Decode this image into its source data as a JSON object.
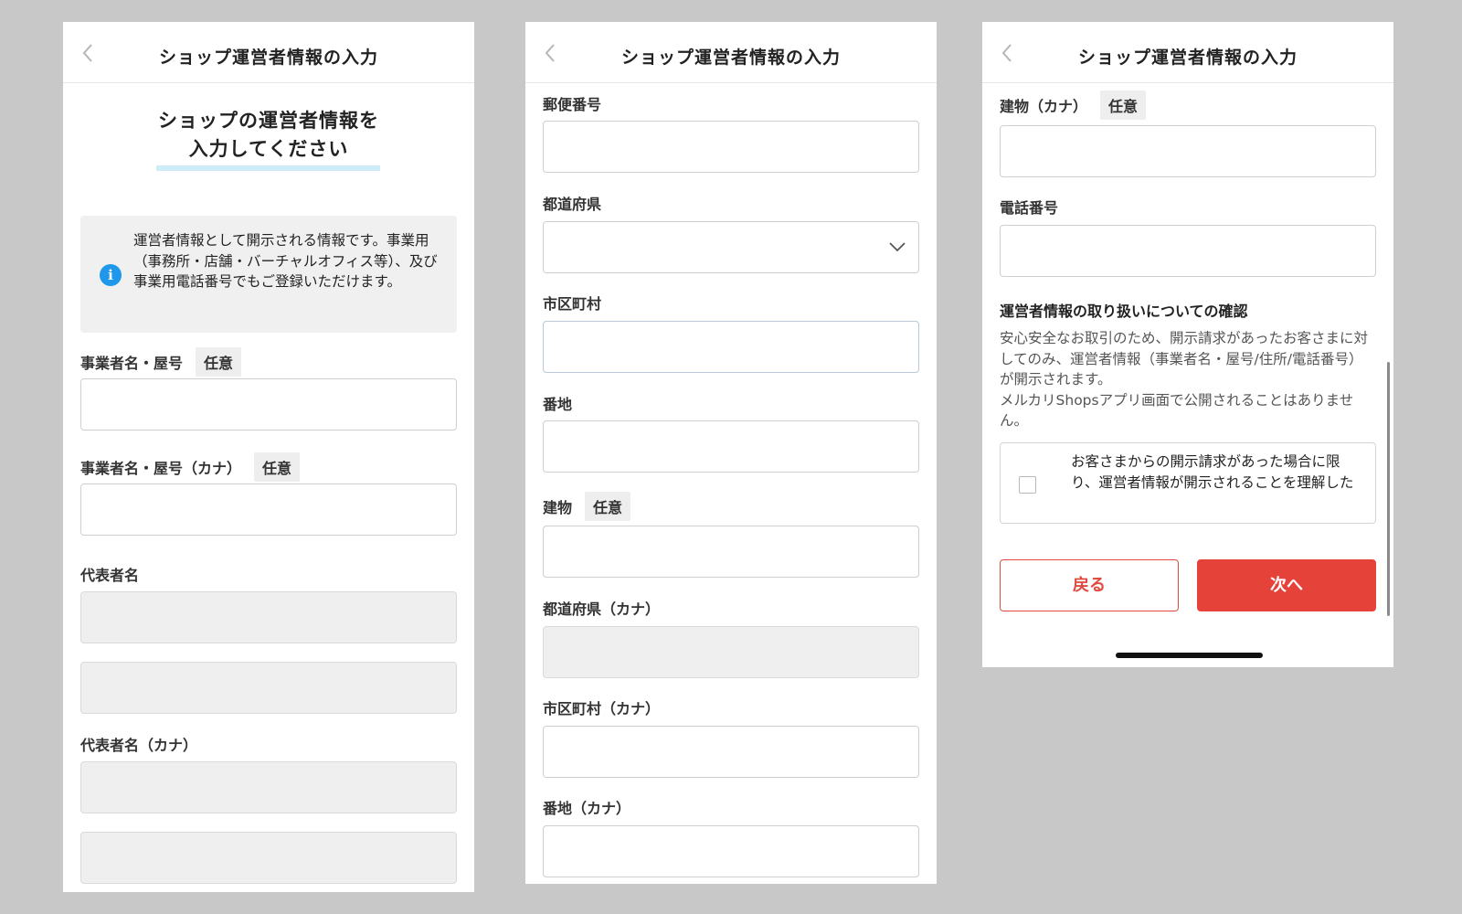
{
  "header": {
    "title": "ショップ運営者情報の入力"
  },
  "screen1": {
    "lead_line1": "ショップの運営者情報を",
    "lead_line2": "入力してください",
    "info_text": "運営者情報として開示される情報です。事業用（事務所・店舗・バーチャルオフィス等）、及び事業用電話番号でもご登録いただけます。",
    "fields": {
      "business_name": {
        "label": "事業者名・屋号",
        "tag": "任意"
      },
      "business_name_kana": {
        "label": "事業者名・屋号（カナ）",
        "tag": "任意"
      },
      "representative": {
        "label": "代表者名"
      },
      "representative_kana": {
        "label": "代表者名（カナ）"
      }
    }
  },
  "screen2": {
    "fields": {
      "postal_code": {
        "label": "郵便番号"
      },
      "prefecture": {
        "label": "都道府県"
      },
      "city": {
        "label": "市区町村"
      },
      "address": {
        "label": "番地"
      },
      "building": {
        "label": "建物",
        "tag": "任意"
      },
      "prefecture_kana": {
        "label": "都道府県（カナ）"
      },
      "city_kana": {
        "label": "市区町村（カナ）"
      },
      "address_kana": {
        "label": "番地（カナ）"
      }
    }
  },
  "screen3": {
    "fields": {
      "building_kana": {
        "label": "建物（カナ）",
        "tag": "任意"
      },
      "phone": {
        "label": "電話番号"
      }
    },
    "confirm_title": "運営者情報の取り扱いについての確認",
    "confirm_desc": "安心安全なお取引のため、開示請求があったお客さまに対してのみ、運営者情報（事業者名・屋号/住所/電話番号）が開示されます。\nメルカリShopsアプリ画面で公開されることはありません。",
    "agree_text": "お客さまからの開示請求があった場合に限り、運営者情報が開示されることを理解した",
    "back_button": "戻る",
    "next_button": "次へ"
  },
  "colors": {
    "accent": "#e5423a",
    "info": "#1f97ea",
    "highlight": "#cfeaf8"
  },
  "icons": {
    "back": "chevron-left-icon",
    "select": "chevron-down-icon",
    "info": "info-icon"
  }
}
